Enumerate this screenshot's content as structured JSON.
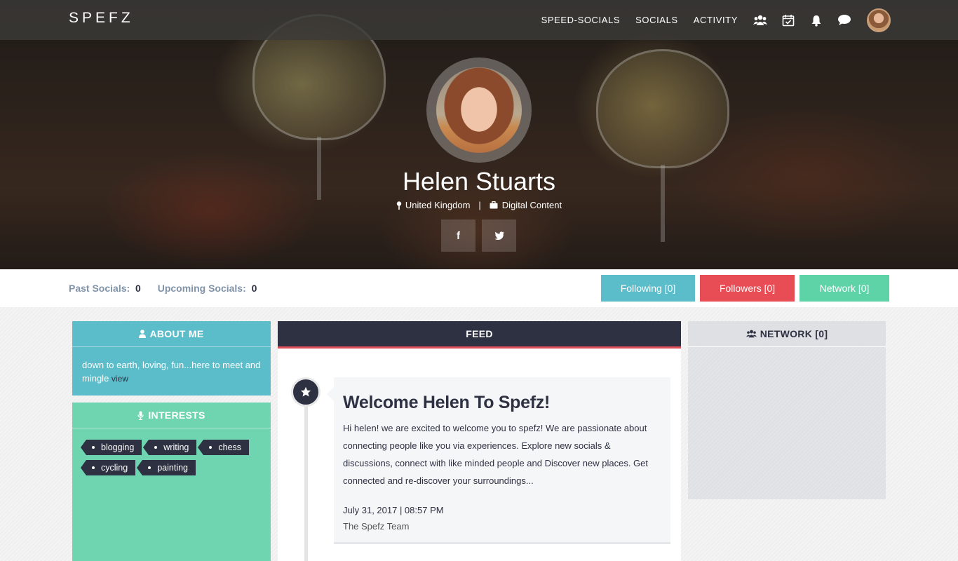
{
  "nav": {
    "logo": "SPEFZ",
    "links": [
      "SPEED-SOCIALS",
      "SOCIALS",
      "ACTIVITY"
    ],
    "icons": [
      "users-icon",
      "calendar-check-icon",
      "bell-icon",
      "chat-bubble-icon"
    ]
  },
  "profile": {
    "name": "Helen Stuarts",
    "location": "United Kingdom",
    "separator": "|",
    "occupation": "Digital Content",
    "facebook_glyph": "f",
    "twitter_glyph": "t"
  },
  "stats": {
    "past_label": "Past Socials:",
    "past_value": "0",
    "upcoming_label": "Upcoming Socials:",
    "upcoming_value": "0"
  },
  "buttons": {
    "following": "Following [0]",
    "followers": "Followers [0]",
    "network": "Network [0]"
  },
  "about": {
    "title": "ABOUT ME",
    "text": "down to earth, loving, fun...here to meet and mingle",
    "view": "view"
  },
  "interests": {
    "title": "INTERESTS",
    "tags": [
      "blogging",
      "writing",
      "chess",
      "cycling",
      "painting"
    ]
  },
  "feed": {
    "title": "FEED",
    "post": {
      "title": "Welcome Helen To Spefz!",
      "body": "Hi helen! we are excited to welcome you to spefz! We are passionate about connecting people like you via experiences. Explore new socials & discussions, connect with like minded people and Discover new places. Get connected and re-discover your surroundings...",
      "date": "July 31, 2017 | 08:57 PM",
      "author": "The Spefz Team"
    }
  },
  "network": {
    "title": "NETWORK [0]"
  },
  "colors": {
    "teal": "#5bbcca",
    "mint": "#6fd4b0",
    "red": "#e84c55",
    "navy": "#2d3142",
    "network_btn": "#5fd3a8"
  }
}
